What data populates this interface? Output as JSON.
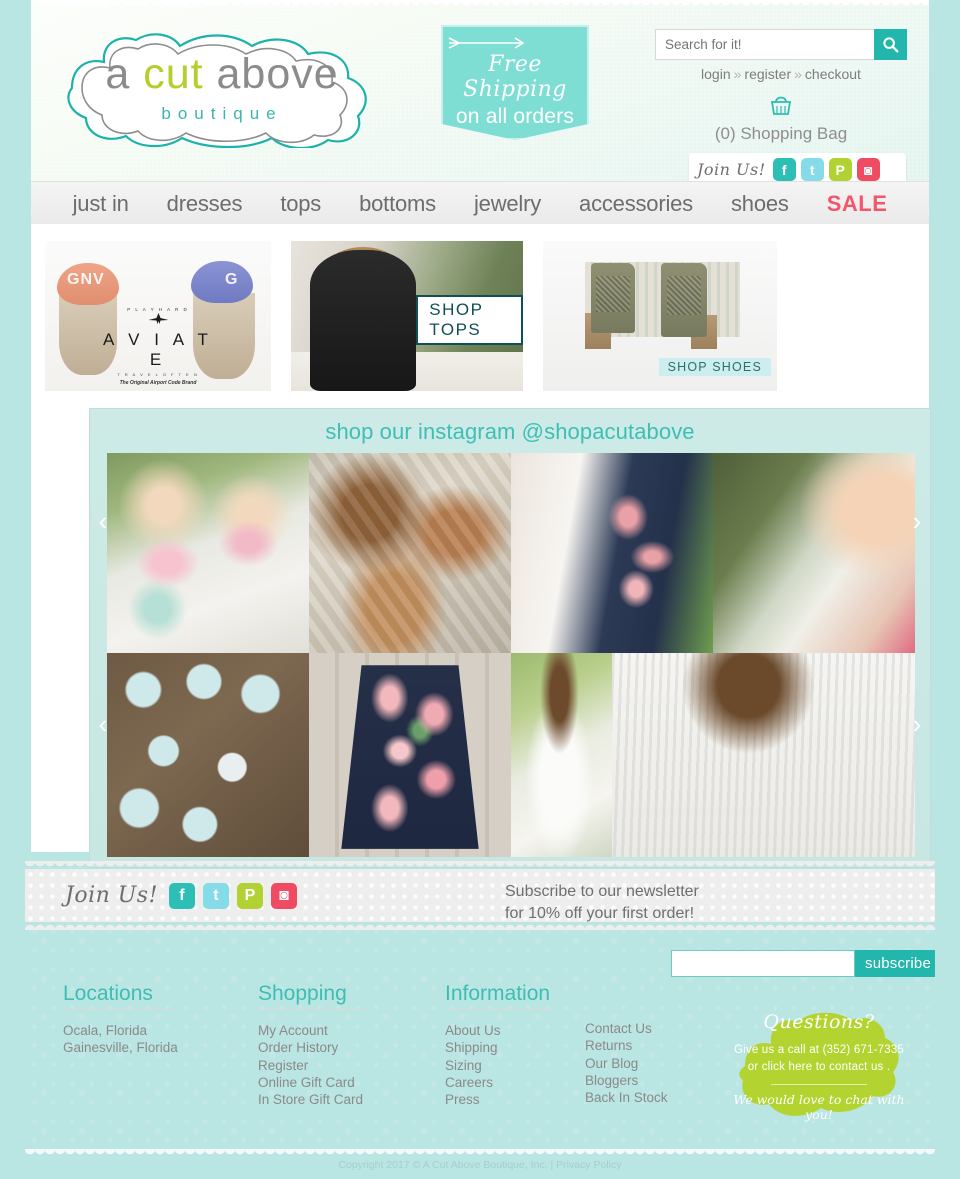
{
  "site": {
    "logo_main_a": "a ",
    "logo_main_cut": "cut",
    "logo_main_above": " above",
    "logo_sub": "boutique"
  },
  "promo": {
    "line1": "Free Shipping",
    "line2": "on all orders",
    "icon": "arrow-right-icon",
    "bg_color": "#7fded4"
  },
  "search": {
    "placeholder": "Search for it!",
    "value": "",
    "icon": "search-icon",
    "button_color": "#23b6ac"
  },
  "account": {
    "login": "login",
    "sep1": "»",
    "register": "register",
    "sep2": "»",
    "checkout": "checkout",
    "bag_icon": "shopping-basket-icon",
    "bag_label": "(0) Shopping Bag"
  },
  "social_header": {
    "label": "Join Us!",
    "items": [
      {
        "name": "facebook-icon",
        "glyph": "f",
        "color": "#2dbfb5"
      },
      {
        "name": "twitter-icon",
        "glyph": "t",
        "color": "#86dbe8"
      },
      {
        "name": "pinterest-icon",
        "glyph": "P",
        "color": "#b2d234"
      },
      {
        "name": "instagram-icon",
        "glyph": "◙",
        "color": "#ef4b63"
      }
    ]
  },
  "nav": {
    "items": [
      {
        "label": "just in",
        "sale": false
      },
      {
        "label": "dresses",
        "sale": false
      },
      {
        "label": "tops",
        "sale": false
      },
      {
        "label": "bottoms",
        "sale": false
      },
      {
        "label": "jewelry",
        "sale": false
      },
      {
        "label": "accessories",
        "sale": false
      },
      {
        "label": "shoes",
        "sale": false
      },
      {
        "label": "SALE",
        "sale": true
      }
    ],
    "sale_color": "#f3566b"
  },
  "banners": [
    {
      "name": "aviate-hats-banner",
      "brand_pre": "P L A Y   H A R D",
      "brand": "A V I A T E",
      "sub1": "T R A V E L   O F T E N",
      "sub2": "The Original Airport Code Brand",
      "caption": ""
    },
    {
      "name": "shop-tops-banner",
      "caption": "SHOP TOPS"
    },
    {
      "name": "shop-shoes-banner",
      "caption": "SHOP SHOES"
    }
  ],
  "instagram": {
    "title": "shop our instagram @shopacutabove",
    "title_color": "#3ebfb6",
    "prev_arrow": "‹",
    "next_arrow": "›",
    "tiles": [
      {
        "name": "ig-tile-floral-tee"
      },
      {
        "name": "ig-tile-brown-sandals"
      },
      {
        "name": "ig-tile-white-dress-mannequin"
      },
      {
        "name": "ig-tile-pink-stripe-top"
      },
      {
        "name": "ig-tile-earrings-flatlay"
      },
      {
        "name": "ig-tile-navy-floral-dress"
      },
      {
        "name": "ig-tile-white-ruffle-dress"
      },
      {
        "name": "ig-tile-white-stripe-dress"
      },
      {
        "name": "ig-tile-floral-tee-blonde"
      }
    ]
  },
  "newsletter": {
    "join_label": "Join Us!",
    "line1": "Subscribe to our newsletter",
    "line2": "for 10% off your first order!",
    "input_value": "",
    "input_placeholder": "",
    "button_label": "subscribe",
    "social": [
      {
        "name": "facebook-icon",
        "glyph": "f",
        "color": "#2dbfb5"
      },
      {
        "name": "twitter-icon",
        "glyph": "t",
        "color": "#86dbe8"
      },
      {
        "name": "pinterest-icon",
        "glyph": "P",
        "color": "#b2d234"
      },
      {
        "name": "instagram-icon",
        "glyph": "◙",
        "color": "#ef4b63"
      }
    ]
  },
  "footer": {
    "columns": [
      {
        "title": "Locations",
        "items": [
          "Ocala, Florida",
          "Gainesville, Florida"
        ]
      },
      {
        "title": "Shopping",
        "items": [
          "My Account",
          "Order History",
          "Register",
          "Online Gift Card",
          "In Store Gift Card"
        ]
      },
      {
        "title": "Information",
        "items": [
          "About Us",
          "Shipping",
          "Sizing",
          "Careers",
          "Press"
        ]
      },
      {
        "title": "",
        "items": [
          "Contact Us",
          "Returns",
          "Our Blog",
          "Bloggers",
          "Back In Stock"
        ]
      }
    ],
    "questions": {
      "title": "Questions?",
      "line1": "Give us a call at (352) 671-7335",
      "line2": "or click here to contact us .",
      "line3": "We would love to chat with you!",
      "color": "#b3d430"
    },
    "copyright": "Copyright 2017 © A Cut Above Boutique, Inc. | Privacy Policy"
  }
}
